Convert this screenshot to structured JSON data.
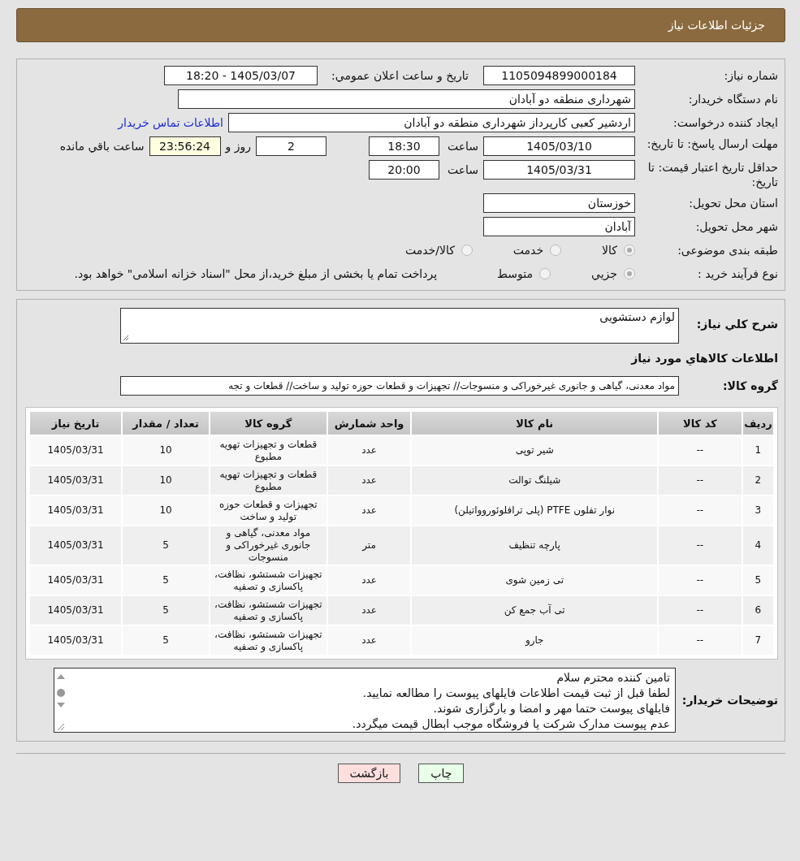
{
  "header": {
    "title": "جزئیات اطلاعات نیاز"
  },
  "details": {
    "need_number": {
      "label": "شماره نیاز:",
      "value": "1105094899000184"
    },
    "announce": {
      "label": "تاریخ و ساعت اعلان عمومي:",
      "value": "1405/03/07 - 18:20"
    },
    "buyer": {
      "label": "نام دستگاه خریدار:",
      "value": "شهرداری منطقه دو آبادان"
    },
    "creator": {
      "label": "ایجاد کننده درخواست:",
      "value": "اردشیر کعبی کارپرداز شهرداری منطقه دو آبادان",
      "link": "اطلاعات تماس خریدار"
    },
    "deadline": {
      "label": "مهلت ارسال پاسخ: تا تاریخ:",
      "date": "1405/03/10",
      "time_label": "ساعت",
      "time": "18:30",
      "days": "2",
      "days_label": "روز و",
      "remaining": "23:56:24",
      "remaining_label": "ساعت باقي مانده"
    },
    "validity": {
      "label": "حداقل تاریخ اعتبار قیمت: تا تاریخ:",
      "date": "1405/03/31",
      "time_label": "ساعت",
      "time": "20:00"
    },
    "province": {
      "label": "استان محل تحویل:",
      "value": "خوزستان"
    },
    "city": {
      "label": "شهر محل تحویل:",
      "value": "آبادان"
    },
    "category": {
      "label": "طبقه بندی موضوعی:",
      "options": [
        {
          "label": "کالا",
          "selected": true
        },
        {
          "label": "خدمت",
          "selected": false
        },
        {
          "label": "کالا/خدمت",
          "selected": false
        }
      ]
    },
    "process": {
      "label": "نوع فرآیند خرید :",
      "options": [
        {
          "label": "جزيي",
          "selected": true
        },
        {
          "label": "متوسط",
          "selected": false
        }
      ],
      "note": "پرداخت تمام یا بخشی از مبلغ خرید،از محل \"اسناد خزانه اسلامی\" خواهد بود."
    }
  },
  "summary": {
    "label": "شرح كلي نياز:",
    "value": "لوازم دستشویی"
  },
  "goods_title": "اطلاعات كالاهاي مورد نياز",
  "goods_group": {
    "label": "گروه کالا:",
    "value": "مواد معدنی، گیاهی و جانوری غیرخوراکی و منسوجات// تجهیزات و قطعات حوزه تولید و ساخت//  قطعات و تجه"
  },
  "table": {
    "columns": [
      "ردیف",
      "کد کالا",
      "نام کالا",
      "واحد شمارش",
      "گروه کالا",
      "تعداد / مقدار",
      "تاریخ نیاز"
    ],
    "rows": [
      [
        "1",
        "--",
        "شیر توپی",
        "عدد",
        "قطعات و تجهیزات تهویه مطبوع",
        "10",
        "1405/03/31"
      ],
      [
        "2",
        "--",
        "شیلنگ توالت",
        "عدد",
        "قطعات و تجهیزات تهویه مطبوع",
        "10",
        "1405/03/31"
      ],
      [
        "3",
        "--",
        "نوار تفلون PTFE (پلی ترافلوئوروواتیلن)",
        "عدد",
        "تجهیزات و قطعات حوزه تولید و ساخت",
        "10",
        "1405/03/31"
      ],
      [
        "4",
        "--",
        "پارچه تنظیف",
        "متر",
        "مواد معدنی، گیاهی و جانوری غیرخوراکی و منسوجات",
        "5",
        "1405/03/31"
      ],
      [
        "5",
        "--",
        "تی زمین شوی",
        "عدد",
        "تجهیزات شستشو، نظافت، پاکسازی و تصفیه",
        "5",
        "1405/03/31"
      ],
      [
        "6",
        "--",
        "تی آب جمع کن",
        "عدد",
        "تجهیزات شستشو، نظافت، پاکسازی و تصفیه",
        "5",
        "1405/03/31"
      ],
      [
        "7",
        "--",
        "جارو",
        "عدد",
        "تجهیزات شستشو، نظافت، پاکسازی و تصفیه",
        "5",
        "1405/03/31"
      ]
    ]
  },
  "buyer_notes": {
    "label": "توضیحات خریدار:",
    "lines": [
      "تامین کننده محترم سلام",
      "لطفا قبل از ثبت قیمت اطلاعات فایلهای پیوست را مطالعه نمایید.",
      "فایلهای پیوست حتما مهر و امضا و بارگزاری شوند.",
      "عدم پیوست مدارک شرکت یا فروشگاه موجب ابطال قیمت میگردد."
    ]
  },
  "buttons": [
    {
      "kind": "print",
      "label": "چاپ"
    },
    {
      "kind": "back",
      "label": "بازگشت"
    }
  ]
}
